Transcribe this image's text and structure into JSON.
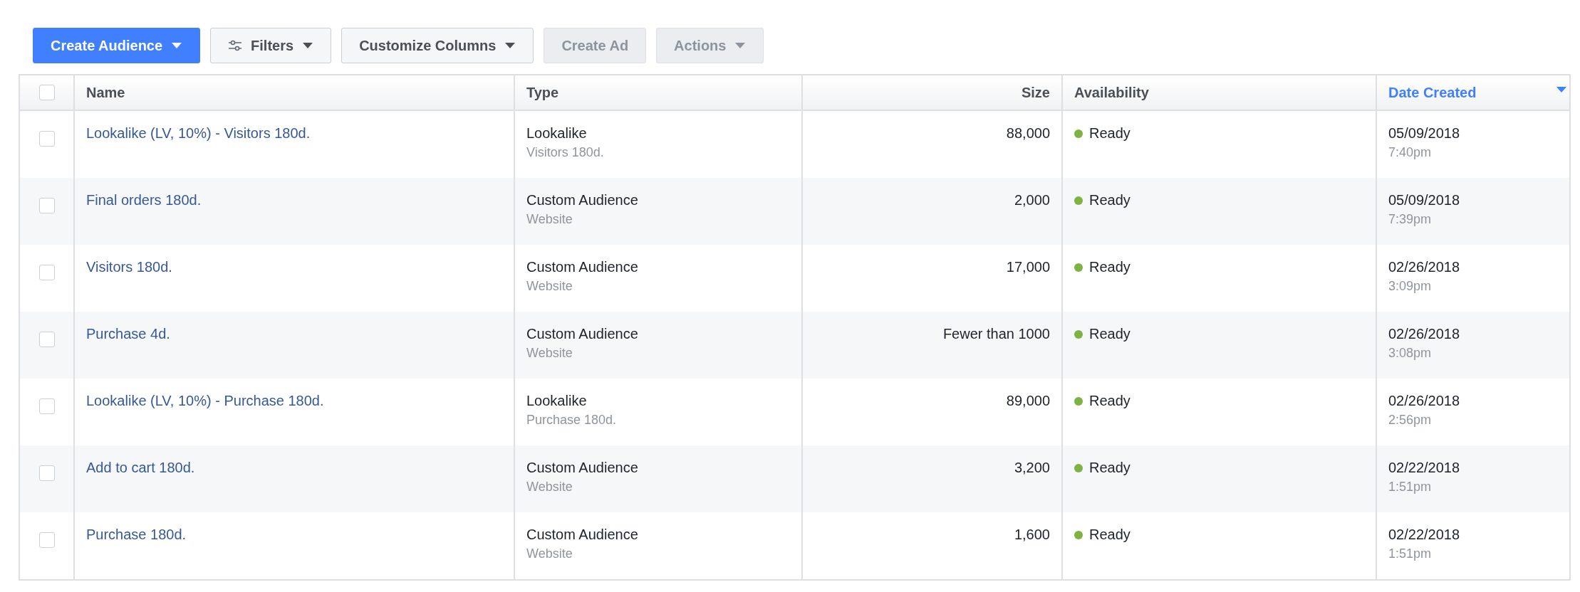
{
  "toolbar": [
    {
      "label": "Create Audience",
      "kind": "primary",
      "dropdown": true,
      "disabled": false
    },
    {
      "label": "Filters",
      "kind": "default",
      "dropdown": true,
      "disabled": false
    },
    {
      "label": "Customize Columns",
      "kind": "default",
      "dropdown": true,
      "disabled": false
    },
    {
      "label": "Create Ad",
      "kind": "default",
      "dropdown": false,
      "disabled": true
    },
    {
      "label": "Actions",
      "kind": "default",
      "dropdown": true,
      "disabled": true
    }
  ],
  "table": {
    "select_all": {
      "checked": false
    },
    "columns": [
      {
        "label": "Name",
        "kind": "text",
        "sorted": false
      },
      {
        "label": "Type",
        "kind": "text",
        "sorted": false
      },
      {
        "label": "Size",
        "kind": "number",
        "sorted": false
      },
      {
        "label": "Availability",
        "kind": "text",
        "sorted": false
      },
      {
        "label": "Date Created",
        "kind": "text",
        "sorted": true
      }
    ],
    "rows": [
      {
        "checked": false,
        "name": "Lookalike (LV, 10%) - Visitors 180d.",
        "type": "Lookalike",
        "subtype": "Visitors 180d.",
        "size": "88,000",
        "availability": {
          "label": "Ready",
          "color": "#7cb342"
        },
        "date": "05/09/2018",
        "time": "7:40pm"
      },
      {
        "checked": false,
        "name": "Final orders 180d.",
        "type": "Custom Audience",
        "subtype": "Website",
        "size": "2,000",
        "availability": {
          "label": "Ready",
          "color": "#7cb342"
        },
        "date": "05/09/2018",
        "time": "7:39pm"
      },
      {
        "checked": false,
        "name": "Visitors 180d.",
        "type": "Custom Audience",
        "subtype": "Website",
        "size": "17,000",
        "availability": {
          "label": "Ready",
          "color": "#7cb342"
        },
        "date": "02/26/2018",
        "time": "3:09pm"
      },
      {
        "checked": false,
        "name": "Purchase 4d.",
        "type": "Custom Audience",
        "subtype": "Website",
        "size": "Fewer than 1000",
        "availability": {
          "label": "Ready",
          "color": "#7cb342"
        },
        "date": "02/26/2018",
        "time": "3:08pm"
      },
      {
        "checked": false,
        "name": "Lookalike (LV, 10%) - Purchase 180d.",
        "type": "Lookalike",
        "subtype": "Purchase 180d.",
        "size": "89,000",
        "availability": {
          "label": "Ready",
          "color": "#7cb342"
        },
        "date": "02/26/2018",
        "time": "2:56pm"
      },
      {
        "checked": false,
        "name": "Add to cart 180d.",
        "type": "Custom Audience",
        "subtype": "Website",
        "size": "3,200",
        "availability": {
          "label": "Ready",
          "color": "#7cb342"
        },
        "date": "02/22/2018",
        "time": "1:51pm"
      },
      {
        "checked": false,
        "name": "Purchase 180d.",
        "type": "Custom Audience",
        "subtype": "Website",
        "size": "1,600",
        "availability": {
          "label": "Ready",
          "color": "#7cb342"
        },
        "date": "02/22/2018",
        "time": "1:51pm"
      }
    ]
  }
}
